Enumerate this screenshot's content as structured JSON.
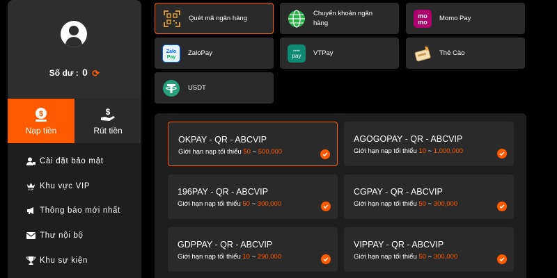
{
  "profile": {
    "balance_label": "Số dư :",
    "balance_value": "0"
  },
  "actions": {
    "deposit_label": "Nạp tiền",
    "withdraw_label": "Rút tiền"
  },
  "menu": [
    {
      "label": "Cài đặt bảo mật",
      "icon": "user-lock-icon"
    },
    {
      "label": "Khu vực VIP",
      "icon": "vip-crown-icon"
    },
    {
      "label": "Thông báo mới nhất",
      "icon": "megaphone-icon"
    },
    {
      "label": "Thư nội bộ",
      "icon": "mail-icon"
    },
    {
      "label": "Khu sự kiện",
      "icon": "trophy-icon"
    }
  ],
  "methods": [
    {
      "label": "Quét mã ngân hàng",
      "icon": "qr-scan-icon",
      "active": true
    },
    {
      "label": "Chuyển khoản ngân hàng",
      "icon": "globe-icon",
      "active": false
    },
    {
      "label": "Momo Pay",
      "icon": "momo-icon",
      "active": false
    },
    {
      "label": "ZaloPay",
      "icon": "zalopay-icon",
      "active": false
    },
    {
      "label": "VTPay",
      "icon": "vtpay-icon",
      "active": false
    },
    {
      "label": "Thẻ Cào",
      "icon": "card-icon",
      "active": false
    },
    {
      "label": "USDT",
      "icon": "tether-icon",
      "active": false
    }
  ],
  "limit_prefix": "Giới hạn nạp tối thiểu",
  "gateways": [
    {
      "name": "OKPAY - QR - ABCVIP",
      "min": "50",
      "max": "500,000",
      "active": true
    },
    {
      "name": "AGOGOPAY - QR - ABCVIP",
      "min": "10",
      "max": "1,000,000",
      "active": false
    },
    {
      "name": "196PAY - QR - ABCVIP",
      "min": "50",
      "max": "300,000",
      "active": false
    },
    {
      "name": "CGPAY - QR - ABCVIP",
      "min": "50",
      "max": "300,000",
      "active": false
    },
    {
      "name": "GDPPAY - QR - ABCVIP",
      "min": "10",
      "max": "290,000",
      "active": false
    },
    {
      "name": "VIPPAY - QR - ABCVIP",
      "min": "50",
      "max": "300,000",
      "active": false
    }
  ],
  "colors": {
    "accent": "#ff5a00",
    "panel": "#1e1e1e",
    "card": "#2a2a2a",
    "background": "#000000"
  }
}
